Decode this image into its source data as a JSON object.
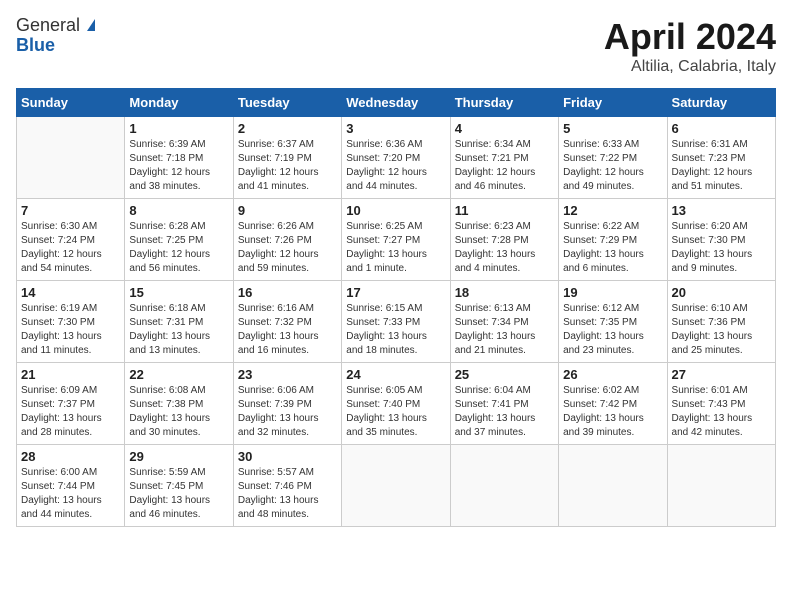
{
  "header": {
    "logo_general": "General",
    "logo_blue": "Blue",
    "month_title": "April 2024",
    "subtitle": "Altilia, Calabria, Italy"
  },
  "days_of_week": [
    "Sunday",
    "Monday",
    "Tuesday",
    "Wednesday",
    "Thursday",
    "Friday",
    "Saturday"
  ],
  "weeks": [
    [
      {
        "day": "",
        "sunrise": "",
        "sunset": "",
        "daylight": ""
      },
      {
        "day": "1",
        "sunrise": "Sunrise: 6:39 AM",
        "sunset": "Sunset: 7:18 PM",
        "daylight": "Daylight: 12 hours and 38 minutes."
      },
      {
        "day": "2",
        "sunrise": "Sunrise: 6:37 AM",
        "sunset": "Sunset: 7:19 PM",
        "daylight": "Daylight: 12 hours and 41 minutes."
      },
      {
        "day": "3",
        "sunrise": "Sunrise: 6:36 AM",
        "sunset": "Sunset: 7:20 PM",
        "daylight": "Daylight: 12 hours and 44 minutes."
      },
      {
        "day": "4",
        "sunrise": "Sunrise: 6:34 AM",
        "sunset": "Sunset: 7:21 PM",
        "daylight": "Daylight: 12 hours and 46 minutes."
      },
      {
        "day": "5",
        "sunrise": "Sunrise: 6:33 AM",
        "sunset": "Sunset: 7:22 PM",
        "daylight": "Daylight: 12 hours and 49 minutes."
      },
      {
        "day": "6",
        "sunrise": "Sunrise: 6:31 AM",
        "sunset": "Sunset: 7:23 PM",
        "daylight": "Daylight: 12 hours and 51 minutes."
      }
    ],
    [
      {
        "day": "7",
        "sunrise": "Sunrise: 6:30 AM",
        "sunset": "Sunset: 7:24 PM",
        "daylight": "Daylight: 12 hours and 54 minutes."
      },
      {
        "day": "8",
        "sunrise": "Sunrise: 6:28 AM",
        "sunset": "Sunset: 7:25 PM",
        "daylight": "Daylight: 12 hours and 56 minutes."
      },
      {
        "day": "9",
        "sunrise": "Sunrise: 6:26 AM",
        "sunset": "Sunset: 7:26 PM",
        "daylight": "Daylight: 12 hours and 59 minutes."
      },
      {
        "day": "10",
        "sunrise": "Sunrise: 6:25 AM",
        "sunset": "Sunset: 7:27 PM",
        "daylight": "Daylight: 13 hours and 1 minute."
      },
      {
        "day": "11",
        "sunrise": "Sunrise: 6:23 AM",
        "sunset": "Sunset: 7:28 PM",
        "daylight": "Daylight: 13 hours and 4 minutes."
      },
      {
        "day": "12",
        "sunrise": "Sunrise: 6:22 AM",
        "sunset": "Sunset: 7:29 PM",
        "daylight": "Daylight: 13 hours and 6 minutes."
      },
      {
        "day": "13",
        "sunrise": "Sunrise: 6:20 AM",
        "sunset": "Sunset: 7:30 PM",
        "daylight": "Daylight: 13 hours and 9 minutes."
      }
    ],
    [
      {
        "day": "14",
        "sunrise": "Sunrise: 6:19 AM",
        "sunset": "Sunset: 7:30 PM",
        "daylight": "Daylight: 13 hours and 11 minutes."
      },
      {
        "day": "15",
        "sunrise": "Sunrise: 6:18 AM",
        "sunset": "Sunset: 7:31 PM",
        "daylight": "Daylight: 13 hours and 13 minutes."
      },
      {
        "day": "16",
        "sunrise": "Sunrise: 6:16 AM",
        "sunset": "Sunset: 7:32 PM",
        "daylight": "Daylight: 13 hours and 16 minutes."
      },
      {
        "day": "17",
        "sunrise": "Sunrise: 6:15 AM",
        "sunset": "Sunset: 7:33 PM",
        "daylight": "Daylight: 13 hours and 18 minutes."
      },
      {
        "day": "18",
        "sunrise": "Sunrise: 6:13 AM",
        "sunset": "Sunset: 7:34 PM",
        "daylight": "Daylight: 13 hours and 21 minutes."
      },
      {
        "day": "19",
        "sunrise": "Sunrise: 6:12 AM",
        "sunset": "Sunset: 7:35 PM",
        "daylight": "Daylight: 13 hours and 23 minutes."
      },
      {
        "day": "20",
        "sunrise": "Sunrise: 6:10 AM",
        "sunset": "Sunset: 7:36 PM",
        "daylight": "Daylight: 13 hours and 25 minutes."
      }
    ],
    [
      {
        "day": "21",
        "sunrise": "Sunrise: 6:09 AM",
        "sunset": "Sunset: 7:37 PM",
        "daylight": "Daylight: 13 hours and 28 minutes."
      },
      {
        "day": "22",
        "sunrise": "Sunrise: 6:08 AM",
        "sunset": "Sunset: 7:38 PM",
        "daylight": "Daylight: 13 hours and 30 minutes."
      },
      {
        "day": "23",
        "sunrise": "Sunrise: 6:06 AM",
        "sunset": "Sunset: 7:39 PM",
        "daylight": "Daylight: 13 hours and 32 minutes."
      },
      {
        "day": "24",
        "sunrise": "Sunrise: 6:05 AM",
        "sunset": "Sunset: 7:40 PM",
        "daylight": "Daylight: 13 hours and 35 minutes."
      },
      {
        "day": "25",
        "sunrise": "Sunrise: 6:04 AM",
        "sunset": "Sunset: 7:41 PM",
        "daylight": "Daylight: 13 hours and 37 minutes."
      },
      {
        "day": "26",
        "sunrise": "Sunrise: 6:02 AM",
        "sunset": "Sunset: 7:42 PM",
        "daylight": "Daylight: 13 hours and 39 minutes."
      },
      {
        "day": "27",
        "sunrise": "Sunrise: 6:01 AM",
        "sunset": "Sunset: 7:43 PM",
        "daylight": "Daylight: 13 hours and 42 minutes."
      }
    ],
    [
      {
        "day": "28",
        "sunrise": "Sunrise: 6:00 AM",
        "sunset": "Sunset: 7:44 PM",
        "daylight": "Daylight: 13 hours and 44 minutes."
      },
      {
        "day": "29",
        "sunrise": "Sunrise: 5:59 AM",
        "sunset": "Sunset: 7:45 PM",
        "daylight": "Daylight: 13 hours and 46 minutes."
      },
      {
        "day": "30",
        "sunrise": "Sunrise: 5:57 AM",
        "sunset": "Sunset: 7:46 PM",
        "daylight": "Daylight: 13 hours and 48 minutes."
      },
      {
        "day": "",
        "sunrise": "",
        "sunset": "",
        "daylight": ""
      },
      {
        "day": "",
        "sunrise": "",
        "sunset": "",
        "daylight": ""
      },
      {
        "day": "",
        "sunrise": "",
        "sunset": "",
        "daylight": ""
      },
      {
        "day": "",
        "sunrise": "",
        "sunset": "",
        "daylight": ""
      }
    ]
  ]
}
